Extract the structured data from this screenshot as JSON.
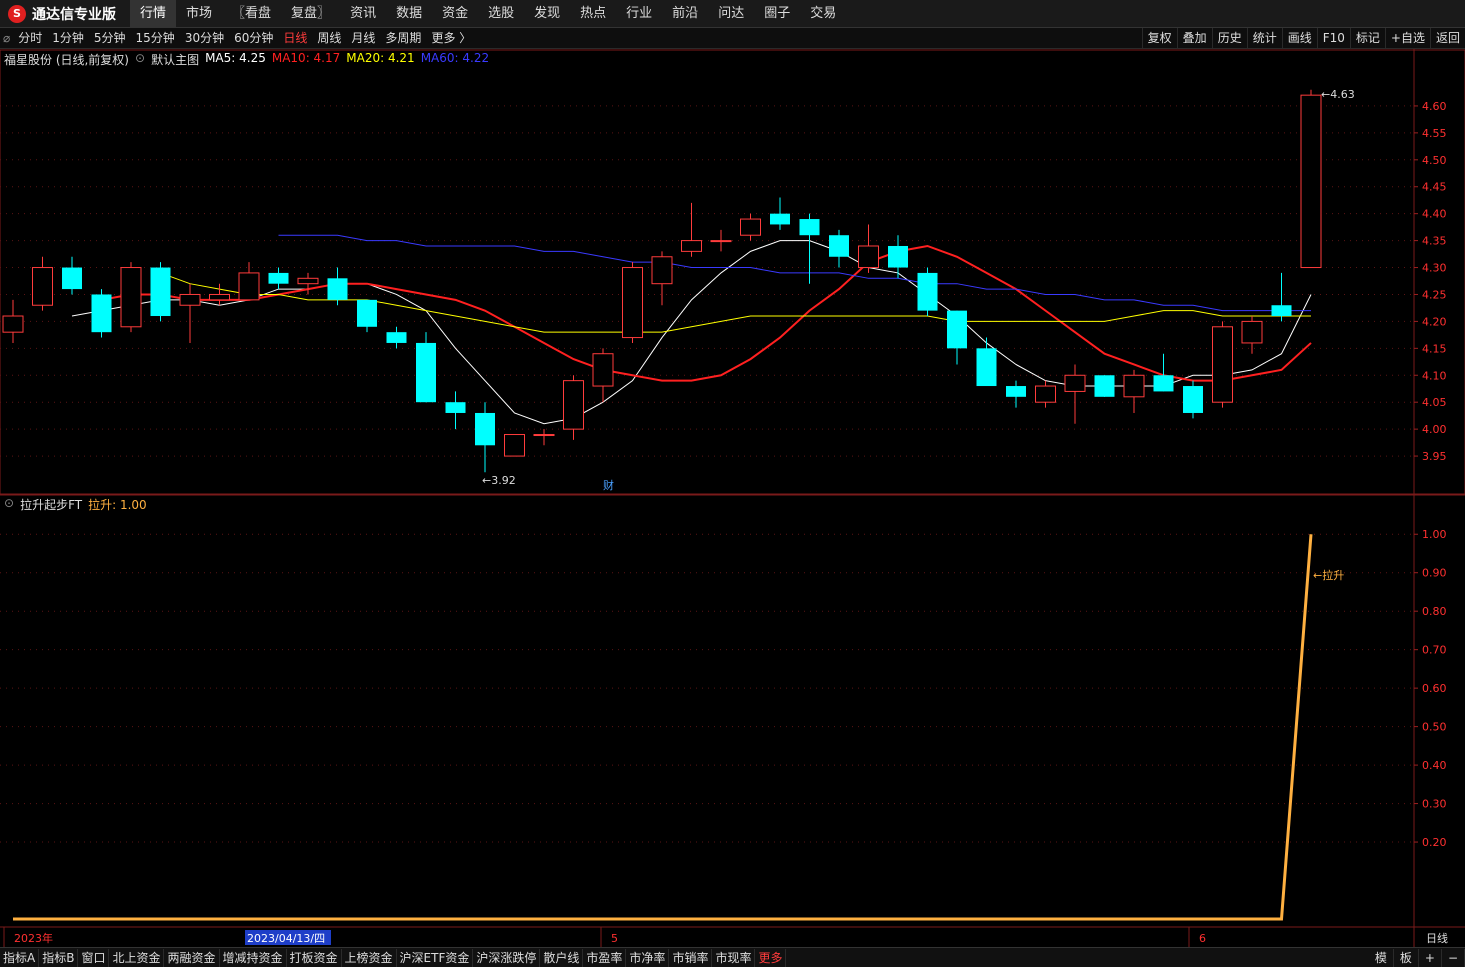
{
  "app": {
    "logo_glyph": "S",
    "name": "通达信专业版"
  },
  "menu": [
    "行情",
    "市场",
    "〖看盘",
    "复盘〗",
    "资讯",
    "数据",
    "资金",
    "选股",
    "发现",
    "热点",
    "行业",
    "前沿",
    "问达",
    "圈子",
    "交易"
  ],
  "periods": [
    "分时",
    "1分钟",
    "5分钟",
    "15分钟",
    "30分钟",
    "60分钟",
    "日线",
    "周线",
    "月线",
    "多周期",
    "更多 〉"
  ],
  "active_period": "日线",
  "tools": [
    "复权",
    "叠加",
    "历史",
    "统计",
    "画线",
    "F10",
    "标记",
    "+自选",
    "返回"
  ],
  "main_chart": {
    "stock_label": "福星股份 (日线,前复权)",
    "indicator_name": "默认主图",
    "ma_labels": [
      {
        "text": "MA5: 4.25",
        "color": "#ffffff"
      },
      {
        "text": "MA10: 4.17",
        "color": "#ff2020"
      },
      {
        "text": "MA20: 4.21",
        "color": "#ffff00"
      },
      {
        "text": "MA60: 4.22",
        "color": "#3a3aff"
      }
    ],
    "max_label": "4.63",
    "min_label": "3.92",
    "marker": "财"
  },
  "sub_chart": {
    "name": "拉升起步FT",
    "value_text": "拉升: 1.00",
    "line_label": "←拉升"
  },
  "xaxis": {
    "labels": [
      "2023年",
      "5",
      "6"
    ],
    "current_date": "2023/04/13/四",
    "period": "日线"
  },
  "bottom_tabs": [
    "指标A",
    "指标B",
    "窗口",
    "北上资金",
    "两融资金",
    "增减持资金",
    "打板资金",
    "上榜资金",
    "沪深ETF资金",
    "沪深涨跌停",
    "散户线",
    "市盈率",
    "市净率",
    "市销率",
    "市现率",
    "更多"
  ],
  "bottom_right": [
    "模",
    "板",
    "+",
    "−"
  ],
  "chart_data": [
    {
      "type": "candlestick",
      "title": "福星股份 (日线,前复权)",
      "ylim": [
        3.9,
        4.65
      ],
      "yticks": [
        3.95,
        4.0,
        4.05,
        4.1,
        4.15,
        4.2,
        4.25,
        4.3,
        4.35,
        4.4,
        4.45,
        4.5,
        4.55,
        4.6
      ],
      "candles": [
        [
          4.18,
          4.21,
          4.24,
          4.16
        ],
        [
          4.23,
          4.3,
          4.32,
          4.22
        ],
        [
          4.3,
          4.26,
          4.32,
          4.25
        ],
        [
          4.25,
          4.18,
          4.26,
          4.17
        ],
        [
          4.19,
          4.3,
          4.31,
          4.18
        ],
        [
          4.3,
          4.21,
          4.31,
          4.2
        ],
        [
          4.23,
          4.25,
          4.27,
          4.16
        ],
        [
          4.24,
          4.25,
          4.27,
          4.23
        ],
        [
          4.24,
          4.29,
          4.31,
          4.24
        ],
        [
          4.29,
          4.27,
          4.3,
          4.26
        ],
        [
          4.27,
          4.28,
          4.29,
          4.25
        ],
        [
          4.28,
          4.24,
          4.3,
          4.23
        ],
        [
          4.24,
          4.19,
          4.24,
          4.18
        ],
        [
          4.18,
          4.16,
          4.19,
          4.15
        ],
        [
          4.16,
          4.05,
          4.18,
          4.05
        ],
        [
          4.05,
          4.03,
          4.07,
          4.0
        ],
        [
          4.03,
          3.97,
          4.05,
          3.92
        ],
        [
          3.95,
          3.99,
          3.99,
          3.95
        ],
        [
          3.99,
          3.99,
          4.0,
          3.97
        ],
        [
          4.0,
          4.09,
          4.1,
          3.98
        ],
        [
          4.08,
          4.14,
          4.15,
          4.05
        ],
        [
          4.17,
          4.3,
          4.31,
          4.16
        ],
        [
          4.27,
          4.32,
          4.33,
          4.23
        ],
        [
          4.33,
          4.35,
          4.42,
          4.32
        ],
        [
          4.35,
          4.35,
          4.37,
          4.33
        ],
        [
          4.36,
          4.39,
          4.4,
          4.35
        ],
        [
          4.4,
          4.38,
          4.43,
          4.37
        ],
        [
          4.39,
          4.36,
          4.4,
          4.27
        ],
        [
          4.36,
          4.32,
          4.37,
          4.3
        ],
        [
          4.3,
          4.34,
          4.38,
          4.29
        ],
        [
          4.34,
          4.3,
          4.36,
          4.28
        ],
        [
          4.29,
          4.22,
          4.3,
          4.21
        ],
        [
          4.22,
          4.15,
          4.22,
          4.12
        ],
        [
          4.15,
          4.08,
          4.17,
          4.08
        ],
        [
          4.08,
          4.06,
          4.09,
          4.04
        ],
        [
          4.05,
          4.08,
          4.09,
          4.04
        ],
        [
          4.07,
          4.1,
          4.12,
          4.01
        ],
        [
          4.1,
          4.06,
          4.1,
          4.06
        ],
        [
          4.06,
          4.1,
          4.11,
          4.03
        ],
        [
          4.1,
          4.07,
          4.14,
          4.07
        ],
        [
          4.08,
          4.03,
          4.09,
          4.02
        ],
        [
          4.05,
          4.19,
          4.2,
          4.04
        ],
        [
          4.16,
          4.2,
          4.21,
          4.14
        ],
        [
          4.23,
          4.21,
          4.29,
          4.2
        ],
        [
          4.3,
          4.62,
          4.63,
          4.3
        ]
      ],
      "series": [
        {
          "name": "MA5",
          "color": "#ffffff",
          "values": [
            4.21,
            4.22,
            4.23,
            4.24,
            4.24,
            4.23,
            4.24,
            4.26,
            4.26,
            4.27,
            4.27,
            4.25,
            4.22,
            4.15,
            4.09,
            4.03,
            4.01,
            4.02,
            4.05,
            4.09,
            4.17,
            4.24,
            4.29,
            4.33,
            4.35,
            4.35,
            4.33,
            4.3,
            4.29,
            4.25,
            4.21,
            4.16,
            4.12,
            4.09,
            4.08,
            4.08,
            4.08,
            4.08,
            4.1,
            4.1,
            4.11,
            4.14,
            4.25
          ]
        },
        {
          "name": "MA10",
          "color": "#ff2020",
          "values": [
            4.24,
            4.25,
            4.25,
            4.24,
            4.24,
            4.24,
            4.25,
            4.26,
            4.27,
            4.27,
            4.26,
            4.25,
            4.24,
            4.22,
            4.19,
            4.16,
            4.13,
            4.11,
            4.1,
            4.09,
            4.09,
            4.1,
            4.13,
            4.17,
            4.22,
            4.26,
            4.31,
            4.33,
            4.34,
            4.32,
            4.29,
            4.26,
            4.22,
            4.18,
            4.14,
            4.12,
            4.1,
            4.09,
            4.09,
            4.1,
            4.11,
            4.16
          ]
        },
        {
          "name": "MA20",
          "color": "#ffff00",
          "values": [
            4.29,
            4.27,
            4.26,
            4.25,
            4.25,
            4.24,
            4.24,
            4.24,
            4.23,
            4.22,
            4.21,
            4.2,
            4.19,
            4.18,
            4.18,
            4.18,
            4.18,
            4.18,
            4.19,
            4.2,
            4.21,
            4.21,
            4.21,
            4.21,
            4.21,
            4.21,
            4.21,
            4.2,
            4.2,
            4.2,
            4.2,
            4.2,
            4.2,
            4.21,
            4.22,
            4.22,
            4.21,
            4.21,
            4.21,
            4.21
          ]
        },
        {
          "name": "MA60",
          "color": "#3a3aff",
          "values": [
            4.36,
            4.36,
            4.36,
            4.35,
            4.35,
            4.34,
            4.34,
            4.34,
            4.34,
            4.33,
            4.33,
            4.32,
            4.31,
            4.31,
            4.3,
            4.3,
            4.3,
            4.29,
            4.29,
            4.29,
            4.28,
            4.28,
            4.27,
            4.27,
            4.26,
            4.26,
            4.25,
            4.25,
            4.24,
            4.24,
            4.23,
            4.23,
            4.22,
            4.22,
            4.22,
            4.22
          ]
        }
      ]
    },
    {
      "type": "line",
      "title": "拉升起步FT",
      "ylim": [
        0,
        1.05
      ],
      "yticks": [
        0.2,
        0.3,
        0.4,
        0.5,
        0.6,
        0.7,
        0.8,
        0.9,
        1.0
      ],
      "series": [
        {
          "name": "拉升",
          "color": "#ffb040",
          "values": [
            0,
            0,
            0,
            0,
            0,
            0,
            0,
            0,
            0,
            0,
            0,
            0,
            0,
            0,
            0,
            0,
            0,
            0,
            0,
            0,
            0,
            0,
            0,
            0,
            0,
            0,
            0,
            0,
            0,
            0,
            0,
            0,
            0,
            0,
            0,
            0,
            0,
            0,
            0,
            0,
            0,
            0,
            0,
            0,
            1.0
          ]
        }
      ]
    }
  ]
}
